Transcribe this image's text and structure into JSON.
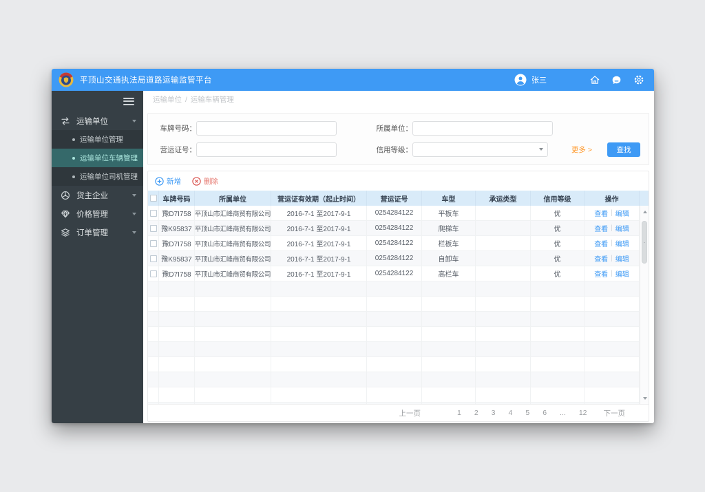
{
  "colors": {
    "accent": "#3e9af5",
    "orange": "#ff9a2e",
    "danger": "#d9534f",
    "danger_text": "#e5756c",
    "active_teal": "#35696a",
    "header_row": "#d9ebf9"
  },
  "header": {
    "title": "平顶山交通执法局道路运输监管平台",
    "user_name": "张三"
  },
  "sidebar": {
    "menu": [
      {
        "name": "transport-unit",
        "icon": "transfer-arrows-icon",
        "label": "运输单位",
        "expanded": true,
        "children": [
          {
            "name": "unit-management",
            "label": "运输单位管理",
            "active": false
          },
          {
            "name": "unit-vehicle-management",
            "label": "运输单位车辆管理",
            "active": true
          },
          {
            "name": "unit-driver-management",
            "label": "运输单位司机管理",
            "active": false
          }
        ]
      },
      {
        "name": "cargo-owner",
        "icon": "wheel-icon",
        "label": "货主企业",
        "expanded": false,
        "children": []
      },
      {
        "name": "price-management",
        "icon": "diamond-icon",
        "label": "价格管理",
        "expanded": false,
        "children": []
      },
      {
        "name": "order-management",
        "icon": "layers-icon",
        "label": "订单管理",
        "expanded": false,
        "children": []
      }
    ]
  },
  "breadcrumb": {
    "parent": "运输单位",
    "separator": "/",
    "current": "运输车辆管理"
  },
  "search": {
    "plate_label": "车牌号码：",
    "plate_value": "",
    "company_label": "所属单位：",
    "company_value": "",
    "cert_label": "营运证号：",
    "cert_value": "",
    "credit_label": "信用等级：",
    "credit_value": "",
    "more_label": "更多 >",
    "search_button": "查找"
  },
  "toolbar": {
    "add_label": "新增",
    "delete_label": "删除"
  },
  "table": {
    "headers": [
      "车牌号码",
      "所属单位",
      "营运证有效期（起止时间）",
      "营运证号",
      "车型",
      "承运类型",
      "信用等级",
      "操作"
    ],
    "actions": {
      "view": "查看",
      "separator": "|",
      "edit": "编辑"
    },
    "rows": [
      {
        "plate": "豫D7I758",
        "company": "平顶山市汇峰商贸有限公司",
        "validity": "2016-7-1 至2017-9-1",
        "cert_no": "0254284122",
        "vehicle_type": "平板车",
        "carry_type": "",
        "credit": "优"
      },
      {
        "plate": "豫K95837",
        "company": "平顶山市汇峰商贸有限公司",
        "validity": "2016-7-1 至2017-9-1",
        "cert_no": "0254284122",
        "vehicle_type": "爬梯车",
        "carry_type": "",
        "credit": "优"
      },
      {
        "plate": "豫D7I758",
        "company": "平顶山市汇峰商贸有限公司",
        "validity": "2016-7-1 至2017-9-1",
        "cert_no": "0254284122",
        "vehicle_type": "栏板车",
        "carry_type": "",
        "credit": "优"
      },
      {
        "plate": "豫K95837",
        "company": "平顶山市汇峰商贸有限公司",
        "validity": "2016-7-1 至2017-9-1",
        "cert_no": "0254284122",
        "vehicle_type": "自卸车",
        "carry_type": "",
        "credit": "优"
      },
      {
        "plate": "豫D7I758",
        "company": "平顶山市汇峰商贸有限公司",
        "validity": "2016-7-1 至2017-9-1",
        "cert_no": "0254284122",
        "vehicle_type": "高栏车",
        "carry_type": "",
        "credit": "优"
      }
    ]
  },
  "pagination": {
    "prev": "上一页",
    "pages": [
      "1",
      "2",
      "3",
      "4",
      "5",
      "6",
      "...",
      "12"
    ],
    "next": "下一页"
  }
}
